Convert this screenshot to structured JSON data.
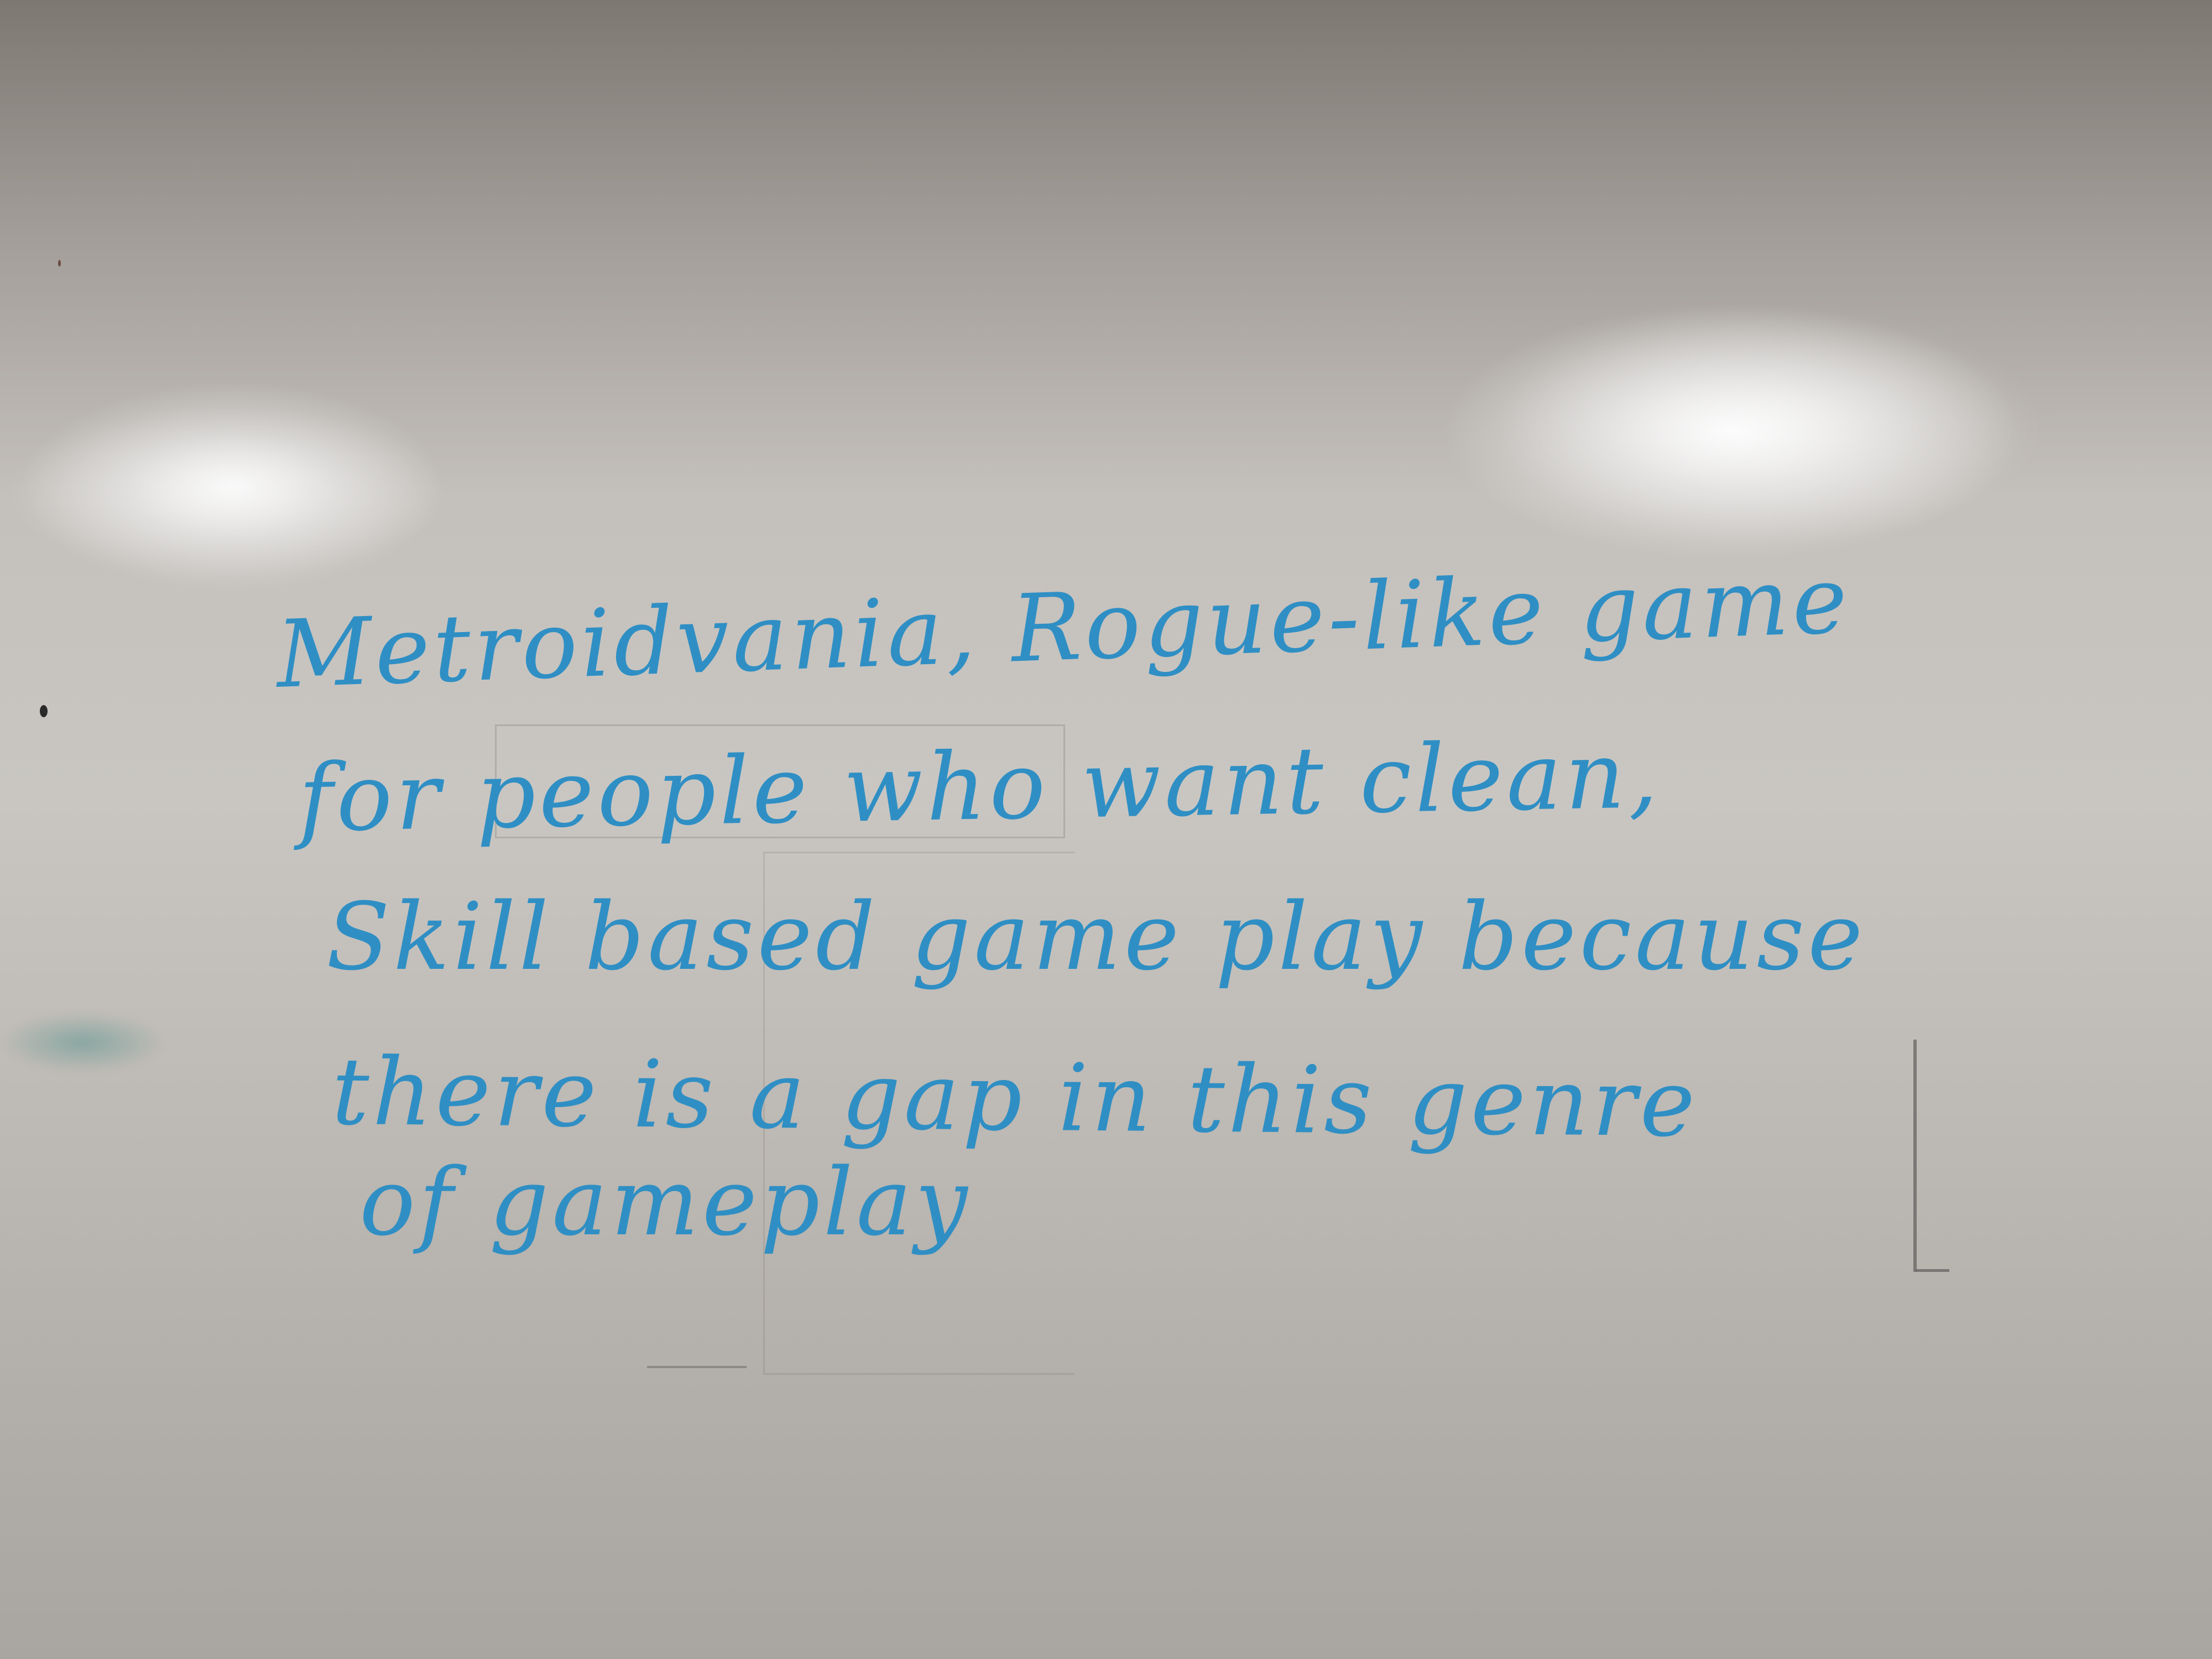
{
  "whiteboard": {
    "lines": [
      "Metroidvania, Rogue-like game",
      "for people who want clean,",
      "Skill based game play because",
      "there is a gap in this genre",
      "of gameplay"
    ],
    "ink_color": "#2f8fc4"
  }
}
